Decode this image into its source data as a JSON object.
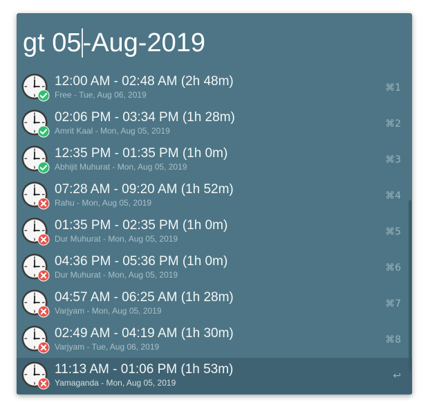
{
  "search": {
    "query_before_caret": "gt 05",
    "query_after_caret": "-Aug-2019"
  },
  "colors": {
    "window_bg": "#4d7585",
    "success": "#2fbf71",
    "danger": "#e8534a"
  },
  "results": [
    {
      "title": "12:00 AM - 02:48 AM (2h 48m)",
      "subtitle": "Free - Tue, Aug 06, 2019",
      "status": "check",
      "shortcut": "⌘1"
    },
    {
      "title": "02:06 PM - 03:34 PM (1h 28m)",
      "subtitle": "Amrit Kaal - Mon, Aug 05, 2019",
      "status": "check",
      "shortcut": "⌘2"
    },
    {
      "title": "12:35 PM - 01:35 PM (1h 0m)",
      "subtitle": "Abhijit Muhurat - Mon, Aug 05, 2019",
      "status": "check",
      "shortcut": "⌘3"
    },
    {
      "title": "07:28 AM - 09:20 AM (1h 52m)",
      "subtitle": "Rahu - Mon, Aug 05, 2019",
      "status": "cross",
      "shortcut": "⌘4"
    },
    {
      "title": "01:35 PM - 02:35 PM (1h 0m)",
      "subtitle": "Dur Muhurat - Mon, Aug 05, 2019",
      "status": "cross",
      "shortcut": "⌘5"
    },
    {
      "title": "04:36 PM - 05:36 PM (1h 0m)",
      "subtitle": "Dur Muhurat - Mon, Aug 05, 2019",
      "status": "cross",
      "shortcut": "⌘6"
    },
    {
      "title": "04:57 AM - 06:25 AM (1h 28m)",
      "subtitle": "Varjyam - Mon, Aug 05, 2019",
      "status": "cross",
      "shortcut": "⌘7"
    },
    {
      "title": "02:49 AM - 04:19 AM (1h 30m)",
      "subtitle": "Varjyam - Tue, Aug 06, 2019",
      "status": "cross",
      "shortcut": "⌘8"
    },
    {
      "title": "11:13 AM - 01:06 PM (1h 53m)",
      "subtitle": "Yamaganda - Mon, Aug 05, 2019",
      "status": "cross",
      "shortcut": "↩",
      "selected": true
    }
  ]
}
